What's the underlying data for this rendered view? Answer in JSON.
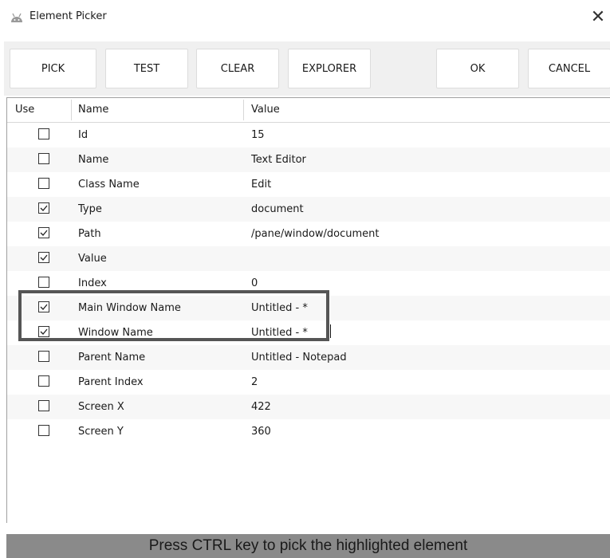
{
  "window": {
    "title": "Element Picker",
    "app_icon": "android-icon",
    "close_glyph": "✕"
  },
  "toolbar": {
    "pick_label": "PICK",
    "test_label": "TEST",
    "clear_label": "CLEAR",
    "explorer_label": "EXPLORER",
    "ok_label": "OK",
    "cancel_label": "CANCEL"
  },
  "grid": {
    "headers": {
      "use": "Use",
      "name": "Name",
      "value": "Value"
    },
    "rows": [
      {
        "checked": false,
        "name": "Id",
        "value": "15"
      },
      {
        "checked": false,
        "name": "Name",
        "value": "Text Editor"
      },
      {
        "checked": false,
        "name": "Class Name",
        "value": "Edit"
      },
      {
        "checked": true,
        "name": "Type",
        "value": "document"
      },
      {
        "checked": true,
        "name": "Path",
        "value": "/pane/window/document"
      },
      {
        "checked": true,
        "name": "Value",
        "value": ""
      },
      {
        "checked": false,
        "name": "Index",
        "value": "0"
      },
      {
        "checked": true,
        "name": "Main Window Name",
        "value": "Untitled - *"
      },
      {
        "checked": true,
        "name": "Window Name",
        "value": "Untitled - *"
      },
      {
        "checked": false,
        "name": "Parent Name",
        "value": "Untitled - Notepad"
      },
      {
        "checked": false,
        "name": "Parent Index",
        "value": "2"
      },
      {
        "checked": false,
        "name": "Screen X",
        "value": "422"
      },
      {
        "checked": false,
        "name": "Screen Y",
        "value": "360"
      }
    ]
  },
  "status": {
    "text": "Press CTRL key to pick the highlighted element"
  },
  "colors": {
    "toolbar_bg": "#f0f0f0",
    "status_bg": "#8a8a8a",
    "highlight_border": "#555555"
  }
}
